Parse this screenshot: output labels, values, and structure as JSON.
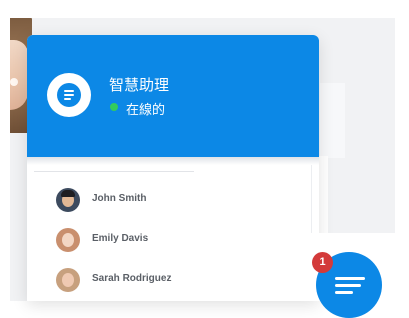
{
  "chat": {
    "header": {
      "assistant_name": "智慧助理",
      "status": "在線的"
    },
    "agents": [
      {
        "name": "John Smith",
        "avatar_icon": "male-avatar-icon"
      },
      {
        "name": "Emily Davis",
        "avatar_icon": "female-avatar-icon"
      },
      {
        "name": "Sarah Rodriguez",
        "avatar_icon": "female-avatar-icon"
      }
    ]
  },
  "launcher": {
    "badge_count": "1",
    "icon": "chat-lines-icon"
  },
  "colors": {
    "accent": "#0c88e6",
    "status_online": "#33cc5c",
    "badge": "#d33a3a"
  }
}
